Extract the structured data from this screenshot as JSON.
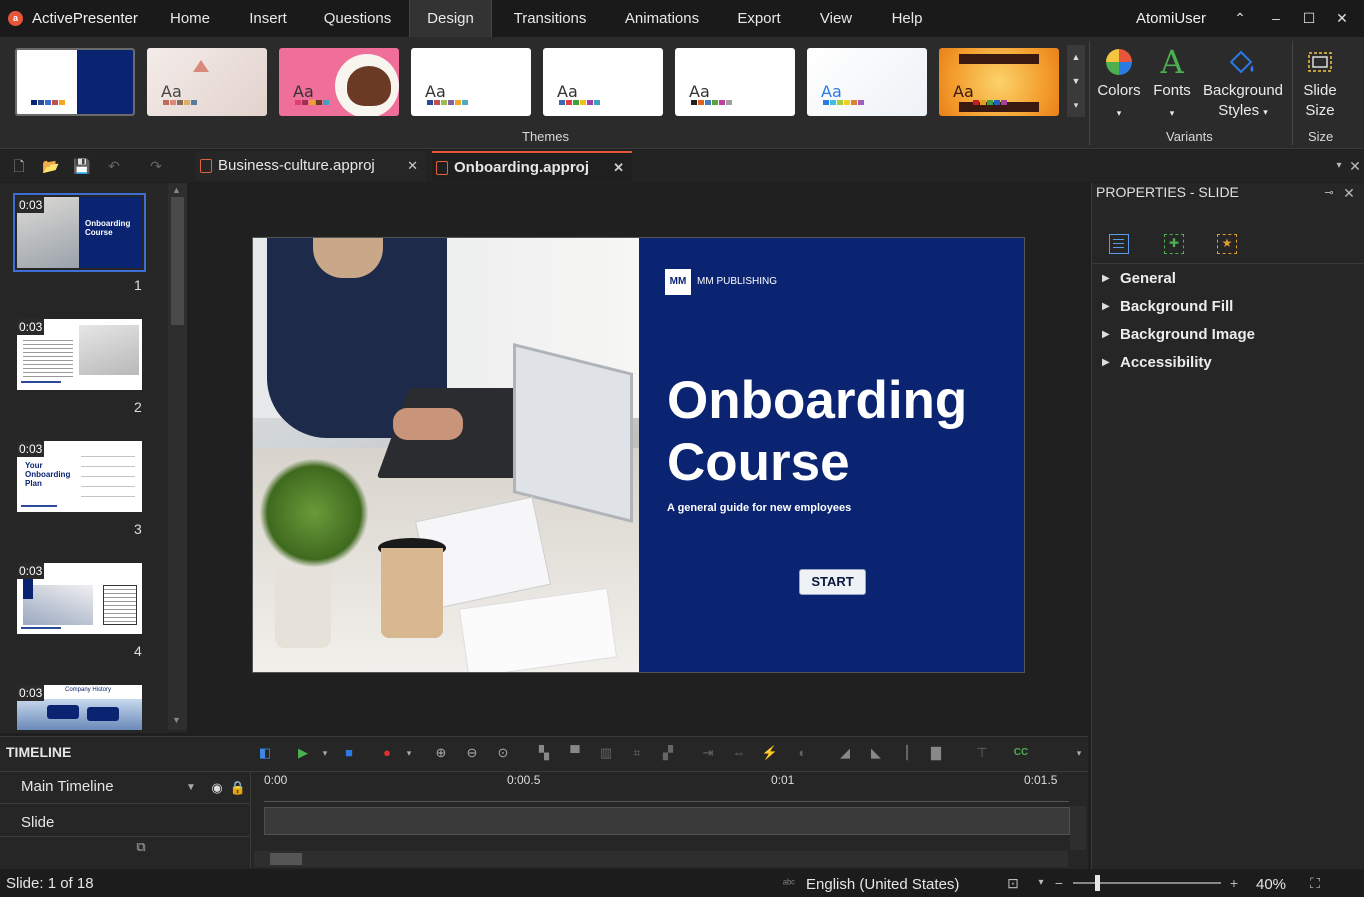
{
  "app": {
    "name": "ActivePresenter",
    "user": "AtomiUser"
  },
  "menu": [
    "Home",
    "Insert",
    "Questions",
    "Design",
    "Transitions",
    "Animations",
    "Export",
    "View",
    "Help"
  ],
  "menu_active": "Design",
  "ribbon": {
    "themes_label": "Themes",
    "theme_aa": "Aa",
    "colors_label": "Colors",
    "fonts_label": "Fonts",
    "bg_styles_label_1": "Background",
    "bg_styles_label_2": "Styles",
    "variants_label": "Variants",
    "slide_size_label_1": "Slide",
    "slide_size_label_2": "Size",
    "size_label": "Size",
    "accent_colors": [
      "#0a2472",
      "#e8563a",
      "#4caf50",
      "#2a7be4"
    ]
  },
  "tabs": [
    {
      "label": "Business-culture.approj",
      "active": false
    },
    {
      "label": "Onboarding.approj",
      "active": true
    }
  ],
  "slides": [
    {
      "num": "1",
      "time": "0:03",
      "title": "Onboarding Course"
    },
    {
      "num": "2",
      "time": "0:03",
      "title": "Welcome to the Onboarding Course!"
    },
    {
      "num": "3",
      "time": "0:03",
      "title": "Your Onboarding Plan"
    },
    {
      "num": "4",
      "time": "0:03",
      "title": "Introduction to the Company"
    },
    {
      "num": "5",
      "time": "0:03",
      "title": "Company History"
    }
  ],
  "slide": {
    "publisher": "MM PUBLISHING",
    "logo_text": "MM",
    "title_line1": "Onboarding",
    "title_line2": "Course",
    "subtitle": "A general guide for new employees",
    "start_button": "START"
  },
  "properties": {
    "title": "PROPERTIES - SLIDE",
    "sections": [
      "General",
      "Background Fill",
      "Background Image",
      "Accessibility"
    ]
  },
  "timeline": {
    "title": "TIMELINE",
    "main_label": "Main Timeline",
    "row_slide": "Slide",
    "ticks": [
      "0:00",
      "0:00.5",
      "0:01",
      "0:01.5"
    ]
  },
  "status": {
    "slide_count": "Slide: 1 of 18",
    "language": "English (United States)",
    "zoom": "40%",
    "zoom_level": 0.16
  }
}
